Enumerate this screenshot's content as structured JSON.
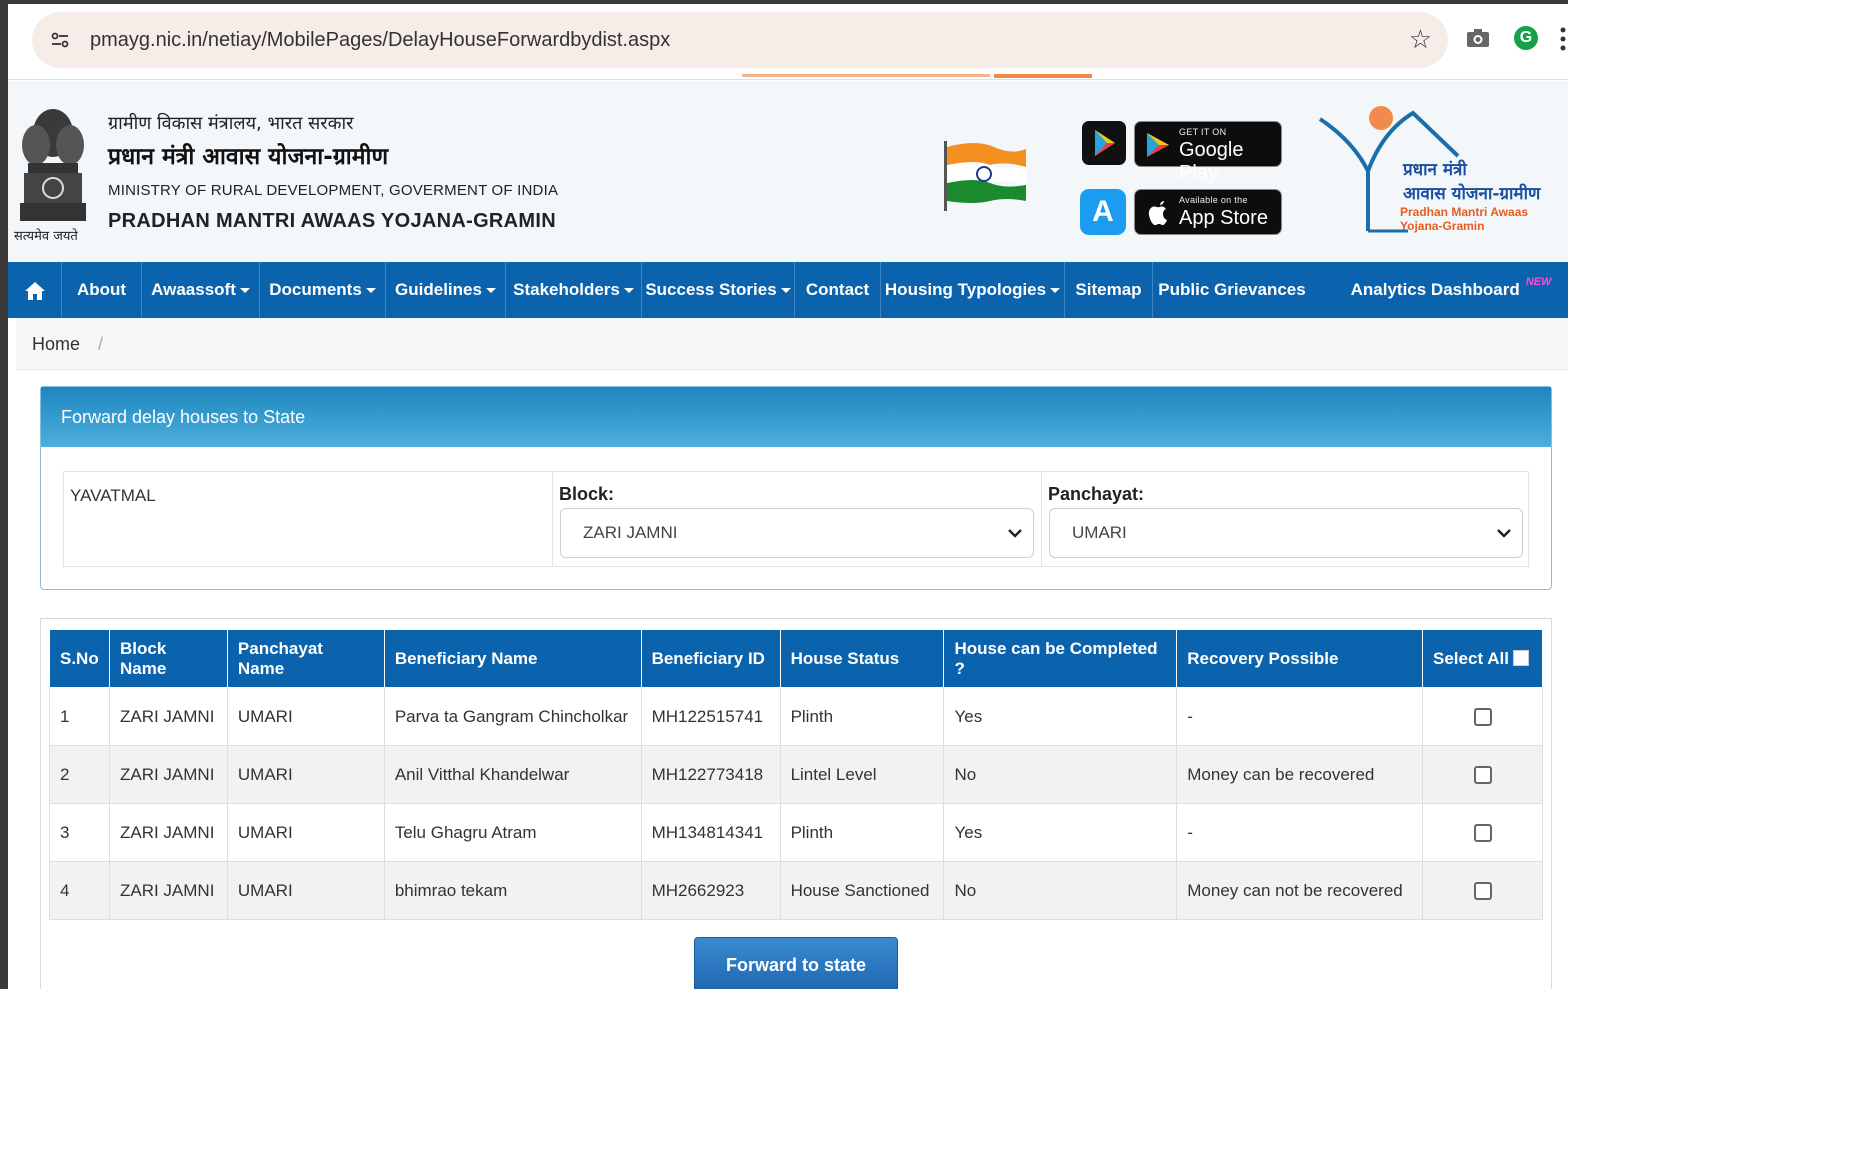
{
  "browser": {
    "url": "pmayg.nic.in/netiay/MobilePages/DelayHouseForwardbydist.aspx"
  },
  "header": {
    "emblem_caption": "सत्यमेव जयते",
    "hindi_ministry": "ग्रामीण विकास मंत्रालय, भारत सरकार",
    "hindi_scheme": "प्रधान मंत्री आवास योजना-ग्रामीण",
    "eng_ministry": "MINISTRY OF RURAL DEVELOPMENT, GOVERMENT OF INDIA",
    "eng_scheme": "PRADHAN MANTRI AWAAS YOJANA-GRAMIN",
    "google_play_small": "GET IT ON",
    "google_play_big": "Google Play",
    "app_store_small": "Available on the",
    "app_store_big": "App Store",
    "logo_line1": "प्रधान मंत्री",
    "logo_line2": "आवास योजना-ग्रामीण",
    "logo_line3": "Pradhan Mantri Awaas Yojana-Gramin"
  },
  "nav": {
    "items": [
      {
        "label": "About"
      },
      {
        "label": "Awaassoft"
      },
      {
        "label": "Documents"
      },
      {
        "label": "Guidelines"
      },
      {
        "label": "Stakeholders"
      },
      {
        "label": "Success Stories"
      },
      {
        "label": "Contact"
      },
      {
        "label": "Housing Typologies"
      },
      {
        "label": "Sitemap"
      },
      {
        "label": "Public Grievances"
      },
      {
        "label": "Analytics Dashboard"
      }
    ],
    "new_badge": "NEW"
  },
  "breadcrumb": {
    "home": "Home",
    "separator": "/"
  },
  "filter_panel": {
    "title": "Forward delay houses to State",
    "district": "YAVATMAL",
    "block_label": "Block:",
    "block_value": "ZARI JAMNI",
    "panchayat_label": "Panchayat:",
    "panchayat_value": "UMARI"
  },
  "table": {
    "headers": [
      "S.No",
      "Block Name",
      "Panchayat Name",
      "Beneficiary Name",
      "Beneficiary ID",
      "House Status",
      "House can be Completed ?",
      "Recovery Possible",
      "Select All"
    ],
    "rows": [
      {
        "sno": "1",
        "block": "ZARI JAMNI",
        "panchayat": "UMARI",
        "name": "Parva ta Gangram Chincholkar",
        "id": "MH122515741",
        "status": "Plinth",
        "completed": "Yes",
        "recovery": "-"
      },
      {
        "sno": "2",
        "block": "ZARI JAMNI",
        "panchayat": "UMARI",
        "name": "Anil Vitthal Khandelwar",
        "id": "MH122773418",
        "status": "Lintel Level",
        "completed": "No",
        "recovery": "Money can be recovered"
      },
      {
        "sno": "3",
        "block": "ZARI JAMNI",
        "panchayat": "UMARI",
        "name": "Telu Ghagru Atram",
        "id": "MH134814341",
        "status": "Plinth",
        "completed": "Yes",
        "recovery": "-"
      },
      {
        "sno": "4",
        "block": "ZARI JAMNI",
        "panchayat": "UMARI",
        "name": "bhimrao tekam",
        "id": "MH2662923",
        "status": "House Sanctioned",
        "completed": "No",
        "recovery": "Money can not be recovered"
      }
    ]
  },
  "actions": {
    "forward_label": "Forward to state"
  },
  "colors": {
    "nav_blue": "#0b63ad",
    "panel_head_blue": "#1e86bf",
    "button_blue": "#1e66b0"
  }
}
